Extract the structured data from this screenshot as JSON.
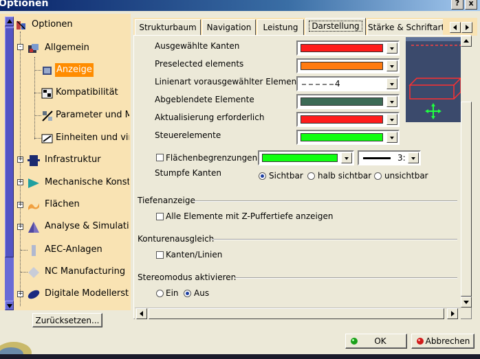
{
  "window": {
    "title": "Optionen",
    "help_btn": "?",
    "close_btn": "x"
  },
  "tree": {
    "items": [
      {
        "label": "Optionen",
        "icon": "options-icon"
      },
      {
        "label": "Allgemein",
        "icon": "general-icon"
      },
      {
        "label": "Anzeige",
        "icon": "display-icon",
        "selected": true
      },
      {
        "label": "Kompatibilität",
        "icon": "compatibility-icon"
      },
      {
        "label": "Parameter und Ma",
        "icon": "parameters-icon"
      },
      {
        "label": "Einheiten und virt",
        "icon": "units-icon"
      },
      {
        "label": "Infrastruktur",
        "icon": "infrastructure-icon"
      },
      {
        "label": "Mechanische Konstru",
        "icon": "mechanical-icon"
      },
      {
        "label": "Flächen",
        "icon": "surfaces-icon"
      },
      {
        "label": "Analyse & Simulation",
        "icon": "analysis-icon"
      },
      {
        "label": "AEC-Anlagen",
        "icon": "aec-icon"
      },
      {
        "label": "NC Manufacturing",
        "icon": "nc-icon"
      },
      {
        "label": "Digitale Modellerstellu",
        "icon": "digital-model-icon"
      }
    ],
    "reset_label": "Zurücksetzen..."
  },
  "tabs": [
    {
      "label": "Strukturbaum"
    },
    {
      "label": "Navigation"
    },
    {
      "label": "Leistung"
    },
    {
      "label": "Darstellung",
      "active": true
    },
    {
      "label": "Stärke & Schriftart"
    }
  ],
  "colors": {
    "red": "#ff1c1c",
    "orange": "#ff7b10",
    "darkgreen": "#3d6b55",
    "green": "#11ff11",
    "tree_bg": "#f9e3b3",
    "selected_bg": "#ff8c00"
  },
  "elements": [
    {
      "label": "Ausgewählte Kanten",
      "color": "#ff1c1c"
    },
    {
      "label": "Preselected elements",
      "color": "#ff7b10"
    },
    {
      "label": "Linienart vorausgewählter Elemente",
      "value": "4"
    },
    {
      "label": "Abgeblendete Elemente",
      "color": "#3d6b55"
    },
    {
      "label": "Aktualisierung erforderlich",
      "color": "#ff1c1c"
    },
    {
      "label": "Steuerelemente",
      "color": "#11ff11"
    }
  ],
  "boundaries": {
    "label": "Flächenbegrenzungen",
    "thickness": "3:"
  },
  "blunt_edges": {
    "label": "Stumpfe Kanten",
    "options": [
      "Sichtbar",
      "halb sichtbar",
      "unsichtbar"
    ]
  },
  "depth": {
    "title": "Tiefenanzeige",
    "checkbox": "Alle Elemente mit Z-Puffertiefe anzeigen"
  },
  "contour": {
    "title": "Konturenausgleich",
    "checkbox": "Kanten/Linien"
  },
  "stereo": {
    "title": "Stereomodus aktivieren",
    "options": [
      "Ein",
      "Aus"
    ]
  },
  "footer": {
    "ok": "OK",
    "cancel": "Abbrechen"
  }
}
